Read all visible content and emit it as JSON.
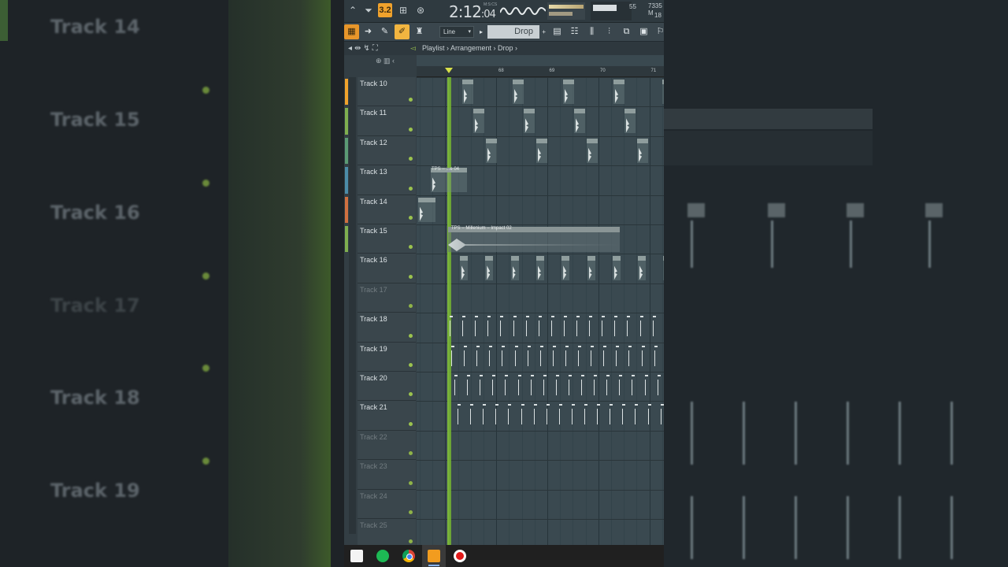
{
  "toolbar": {
    "time_main": "2:12",
    "time_sub": ":04",
    "time_unit": "M:S:CS",
    "mode_label": "3.2",
    "cpu_value": "55",
    "memory_value": "7335 M",
    "poly_value": "18"
  },
  "tools": {
    "snap_label": "Line",
    "pattern_label": "Drop"
  },
  "breadcrumb": {
    "path": "Playlist › Arrangement › Drop ›"
  },
  "ruler_ticks": [
    "68",
    "69",
    "70",
    "71"
  ],
  "tracks": [
    {
      "name": "Track 10",
      "empty": false,
      "color": "#f0a22c"
    },
    {
      "name": "Track 11",
      "empty": false,
      "color": "#7fae4f"
    },
    {
      "name": "Track 12",
      "empty": false,
      "color": "#5b9a74"
    },
    {
      "name": "Track 13",
      "empty": false,
      "color": "#4c8ca8"
    },
    {
      "name": "Track 14",
      "empty": false,
      "color": "#d07040"
    },
    {
      "name": "Track 15",
      "empty": false,
      "color": "#7fae4f"
    },
    {
      "name": "Track 16",
      "empty": false,
      "color": ""
    },
    {
      "name": "Track 17",
      "empty": true,
      "color": ""
    },
    {
      "name": "Track 18",
      "empty": false,
      "color": ""
    },
    {
      "name": "Track 19",
      "empty": false,
      "color": ""
    },
    {
      "name": "Track 20",
      "empty": false,
      "color": ""
    },
    {
      "name": "Track 21",
      "empty": false,
      "color": ""
    },
    {
      "name": "Track 22",
      "empty": true,
      "color": ""
    },
    {
      "name": "Track 23",
      "empty": true,
      "color": ""
    },
    {
      "name": "Track 24",
      "empty": true,
      "color": ""
    },
    {
      "name": "Track 25",
      "empty": true,
      "color": ""
    }
  ],
  "clips": {
    "track13_label": "TPS – ...e 04",
    "track15_label": "TPS – Millenium – Impact 02"
  },
  "background_labels": [
    "Track 14",
    "Track 15",
    "Track 16",
    "Track 17",
    "Track 18",
    "Track 19"
  ],
  "taskbar": {
    "icons": [
      "store-icon",
      "spotify-icon",
      "chrome-icon",
      "fl-studio-icon",
      "record-icon"
    ]
  },
  "colors": {
    "accent": "#f0a22c",
    "playhead": "#8ccf3a",
    "grid": "#3a4950"
  }
}
